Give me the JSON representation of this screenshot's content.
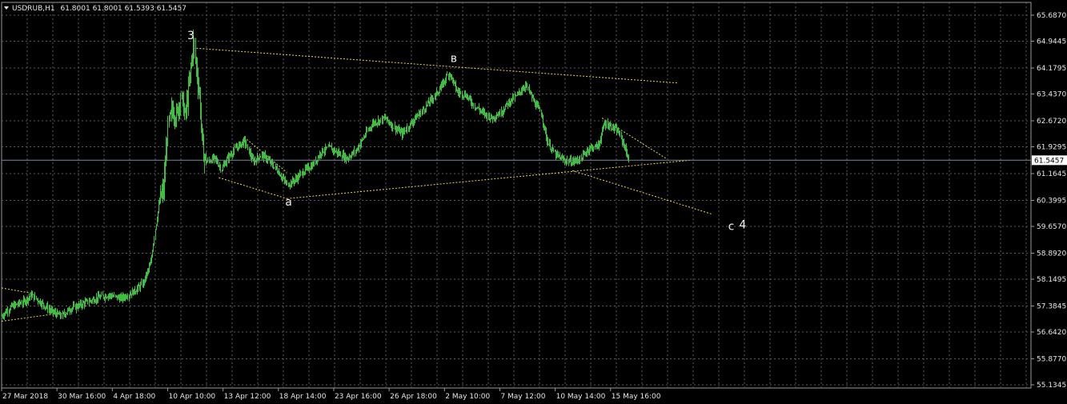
{
  "header": {
    "symbol": "USDRUB,H1",
    "ohlc": "61.8001 61.8001 61.5393 61.5457",
    "menu_icon": "triangle-down-icon"
  },
  "colors": {
    "background": "#000000",
    "grid": "#5a5a5a",
    "candles": "#3fbf3f",
    "trendlines": "#e6d84a",
    "price_line": "#7a8a9a",
    "text": "#e6e6e6"
  },
  "chart_data": {
    "type": "line",
    "title": "USDRUB,H1 61.8001 61.8001 61.5393 61.5457",
    "xlabel": "",
    "ylabel": "",
    "ylim": [
      55.1515,
      65.687
    ],
    "grid": true,
    "legend": "none",
    "current_price": 61.5457,
    "current_price_label": "61.5457",
    "y_ticks": [
      "65.6870",
      "64.9445",
      "64.1795",
      "63.4370",
      "62.6720",
      "61.9295",
      "61.1645",
      "60.3995",
      "59.6570",
      "58.8920",
      "58.1495",
      "57.3845",
      "56.6420",
      "55.8770",
      "55.1345"
    ],
    "x_ticks": [
      "27 Mar 2018",
      "30 Mar 16:00",
      "4 Apr 18:00",
      "10 Apr 10:00",
      "13 Apr 12:00",
      "18 Apr 14:00",
      "23 Apr 16:00",
      "26 Apr 18:00",
      "2 May 10:00",
      "7 May 12:00",
      "10 May 14:00",
      "15 May 16:00"
    ],
    "x_tick_index": [
      0,
      65,
      130,
      195,
      260,
      325,
      390,
      455,
      520,
      585,
      650,
      715
    ],
    "bar_count": 737,
    "series": [
      {
        "values_anchor": [
          [
            0,
            57.1
          ],
          [
            10,
            57.35
          ],
          [
            25,
            57.5
          ],
          [
            35,
            57.7
          ],
          [
            45,
            57.5
          ],
          [
            60,
            57.2
          ],
          [
            70,
            57.1
          ],
          [
            80,
            57.3
          ],
          [
            95,
            57.45
          ],
          [
            110,
            57.6
          ],
          [
            125,
            57.7
          ],
          [
            140,
            57.6
          ],
          [
            155,
            57.8
          ],
          [
            165,
            58.0
          ],
          [
            175,
            58.6
          ],
          [
            180,
            59.6
          ],
          [
            185,
            60.4
          ],
          [
            190,
            60.7
          ],
          [
            195,
            62.5
          ],
          [
            200,
            63.0
          ],
          [
            205,
            62.8
          ],
          [
            210,
            63.4
          ],
          [
            215,
            62.8
          ],
          [
            220,
            63.7
          ],
          [
            225,
            64.9
          ],
          [
            228,
            64.2
          ],
          [
            232,
            63.4
          ],
          [
            236,
            61.8
          ],
          [
            240,
            61.5
          ],
          [
            250,
            61.6
          ],
          [
            258,
            61.3
          ],
          [
            265,
            61.6
          ],
          [
            275,
            61.9
          ],
          [
            285,
            62.1
          ],
          [
            295,
            61.5
          ],
          [
            305,
            61.7
          ],
          [
            315,
            61.5
          ],
          [
            325,
            61.2
          ],
          [
            335,
            60.85
          ],
          [
            345,
            61.0
          ],
          [
            355,
            61.25
          ],
          [
            365,
            61.4
          ],
          [
            375,
            61.8
          ],
          [
            385,
            61.9
          ],
          [
            395,
            61.75
          ],
          [
            405,
            61.6
          ],
          [
            415,
            61.8
          ],
          [
            425,
            62.2
          ],
          [
            435,
            62.6
          ],
          [
            450,
            62.75
          ],
          [
            460,
            62.5
          ],
          [
            470,
            62.3
          ],
          [
            480,
            62.6
          ],
          [
            495,
            63.0
          ],
          [
            505,
            63.3
          ],
          [
            515,
            63.6
          ],
          [
            525,
            64.05
          ],
          [
            535,
            63.5
          ],
          [
            545,
            63.4
          ],
          [
            555,
            63.1
          ],
          [
            565,
            62.9
          ],
          [
            575,
            62.75
          ],
          [
            585,
            62.9
          ],
          [
            595,
            63.2
          ],
          [
            605,
            63.4
          ],
          [
            615,
            63.7
          ],
          [
            625,
            63.2
          ],
          [
            633,
            62.9
          ],
          [
            640,
            62.1
          ],
          [
            650,
            61.7
          ],
          [
            660,
            61.55
          ],
          [
            670,
            61.5
          ],
          [
            680,
            61.6
          ],
          [
            690,
            61.9
          ],
          [
            700,
            61.95
          ],
          [
            708,
            62.6
          ],
          [
            716,
            62.5
          ],
          [
            724,
            62.35
          ],
          [
            730,
            62.0
          ],
          [
            736,
            61.55
          ]
        ]
      }
    ],
    "trendlines": [
      {
        "from": [
          0,
          57.9
        ],
        "to": [
          35,
          57.75
        ],
        "style": "dotted"
      },
      {
        "from": [
          0,
          56.95
        ],
        "to": [
          75,
          57.2
        ],
        "style": "dotted"
      },
      {
        "from": [
          225,
          64.75
        ],
        "to": [
          795,
          63.75
        ],
        "style": "dotted"
      },
      {
        "from": [
          255,
          61.05
        ],
        "to": [
          335,
          60.45
        ],
        "style": "dotted"
      },
      {
        "from": [
          335,
          60.45
        ],
        "to": [
          810,
          61.55
        ],
        "style": "dotted"
      },
      {
        "from": [
          285,
          62.2
        ],
        "to": [
          335,
          61.2
        ],
        "style": "dotted"
      },
      {
        "from": [
          670,
          61.25
        ],
        "to": [
          835,
          60.0
        ],
        "style": "dotted"
      },
      {
        "from": [
          705,
          62.75
        ],
        "to": [
          780,
          61.6
        ],
        "style": "dotted"
      }
    ],
    "wave_labels": [
      {
        "text": "3",
        "at": [
          218,
          65.0
        ]
      },
      {
        "text": "a",
        "at": [
          333,
          60.25
        ]
      },
      {
        "text": "в",
        "at": [
          527,
          64.35
        ]
      },
      {
        "text": "c",
        "at": [
          853,
          59.55
        ]
      },
      {
        "text": "4",
        "at": [
          866,
          59.6
        ]
      }
    ]
  }
}
